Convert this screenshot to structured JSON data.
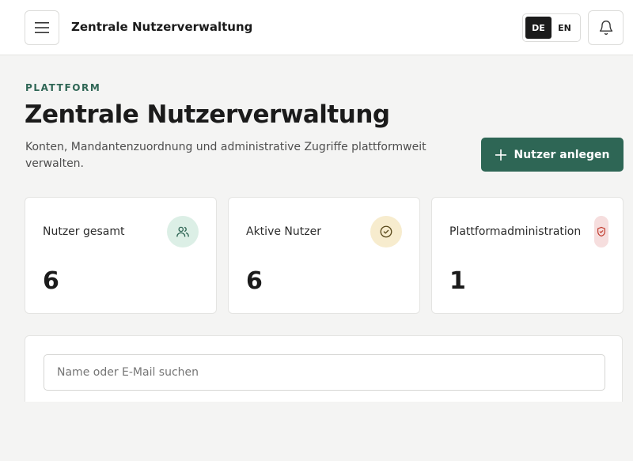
{
  "header": {
    "app_title": "Zentrale Nutzerverwaltung",
    "languages": [
      {
        "code": "DE",
        "active": true
      },
      {
        "code": "EN",
        "active": false
      }
    ],
    "menu_icon": "hamburger-icon",
    "notification_icon": "bell-icon"
  },
  "page": {
    "eyebrow": "PLATTFORM",
    "title": "Zentrale Nutzerverwaltung",
    "description": "Konten, Mandantenzuordnung und administrative Zugriffe plattformweit verwalten.",
    "primary_action": {
      "label": "Nutzer anlegen",
      "icon": "plus-icon"
    }
  },
  "stats": [
    {
      "label": "Nutzer gesamt",
      "value": "6",
      "icon": "users-icon",
      "icon_bg": "#dcefe6",
      "icon_color": "#2f6655"
    },
    {
      "label": "Aktive Nutzer",
      "value": "6",
      "icon": "check-circle-icon",
      "icon_bg": "#f7ecce",
      "icon_color": "#5a4a1c"
    },
    {
      "label": "Plattformadministration",
      "value": "1",
      "icon": "shield-icon",
      "icon_bg": "#f6dede",
      "icon_color": "#c0392b"
    }
  ],
  "filters": {
    "search_placeholder": "Name oder E-Mail suchen",
    "search_value": ""
  },
  "colors": {
    "accent": "#2e6655",
    "background": "#f4f4f3",
    "surface": "#ffffff"
  }
}
